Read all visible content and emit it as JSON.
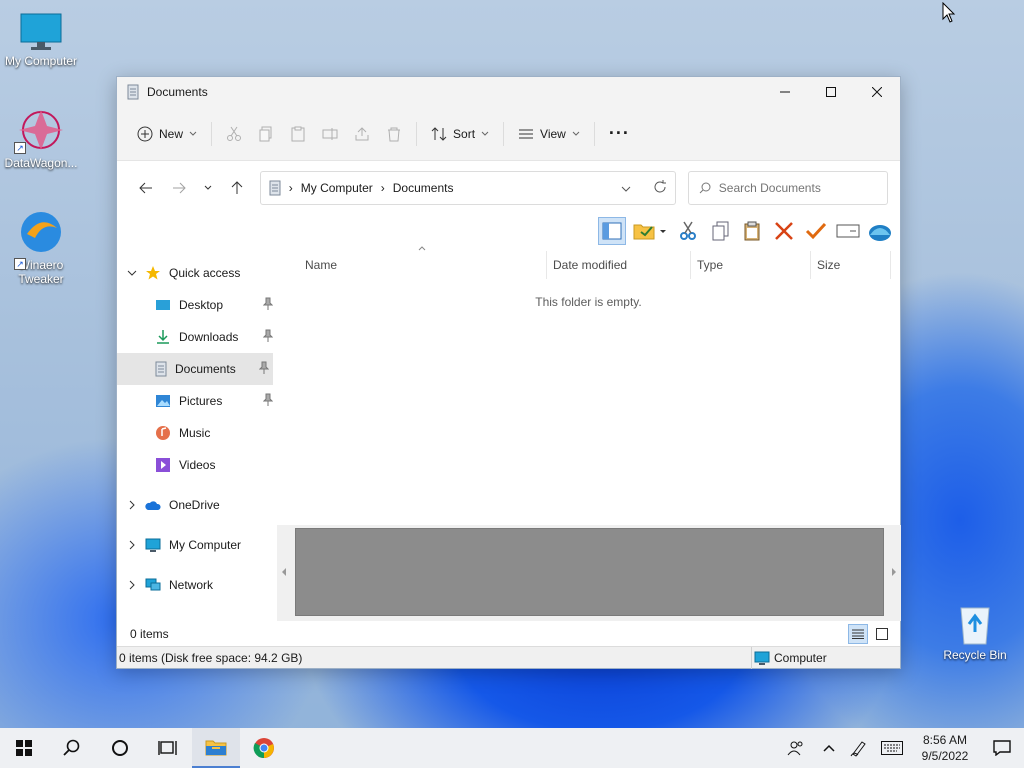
{
  "desktop": {
    "icons": [
      {
        "label": "My Computer"
      },
      {
        "label": "DataWagon..."
      },
      {
        "label": "Winaero Tweaker"
      },
      {
        "label": "Recycle Bin"
      }
    ]
  },
  "window": {
    "title": "Documents",
    "toolbar": {
      "new_label": "New",
      "sort_label": "Sort",
      "view_label": "View",
      "more_label": "···"
    },
    "address": {
      "segments": [
        "My Computer",
        "Documents"
      ]
    },
    "search": {
      "placeholder": "Search Documents"
    },
    "sidebar": {
      "quick_access": "Quick access",
      "items": [
        {
          "label": "Desktop"
        },
        {
          "label": "Downloads"
        },
        {
          "label": "Documents"
        },
        {
          "label": "Pictures"
        },
        {
          "label": "Music"
        },
        {
          "label": "Videos"
        }
      ],
      "onedrive": "OneDrive",
      "my_computer": "My Computer",
      "network": "Network"
    },
    "columns": [
      "Name",
      "Date modified",
      "Type",
      "Size"
    ],
    "empty_message": "This folder is empty.",
    "item_count": "0 items",
    "status_text": "0 items (Disk free space: 94.2 GB)",
    "status_location": "Computer"
  },
  "taskbar": {
    "time": "8:56 AM",
    "date": "9/5/2022"
  },
  "colors": {
    "accent": "#0067c0",
    "selected_nav": "#e5e5e5",
    "folder_yellow": "#f7c244"
  }
}
